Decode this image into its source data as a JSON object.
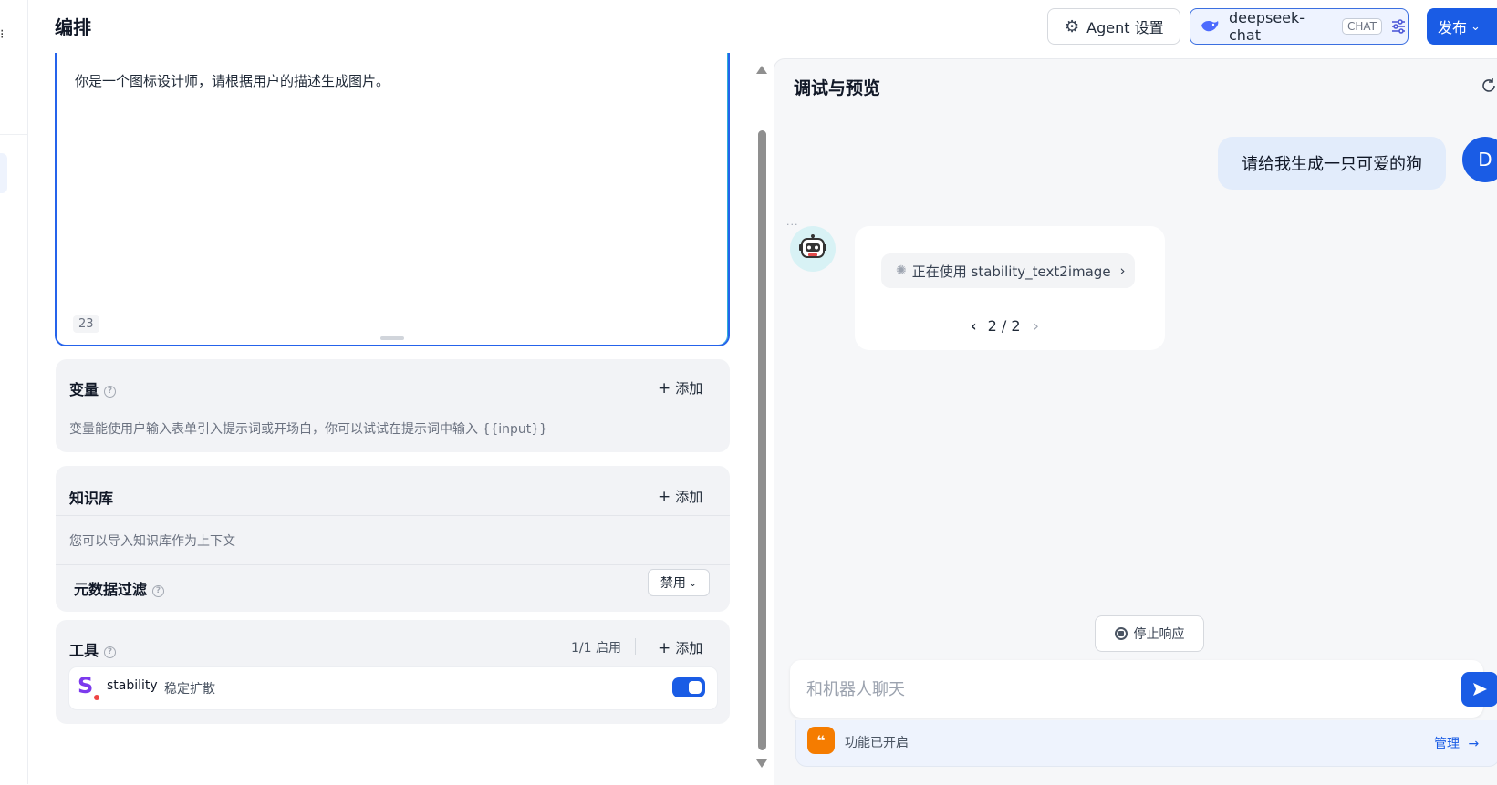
{
  "header": {
    "title": "编排",
    "agent_settings_label": "Agent 设置",
    "model_name": "deepseek-chat",
    "model_badge": "CHAT",
    "publish_label": "发布"
  },
  "prompt": {
    "text": "你是一个图标设计师，请根据用户的描述生成图片。",
    "char_count": "23"
  },
  "variables": {
    "title": "变量",
    "add_label": "添加",
    "description": "变量能使用户输入表单引入提示词或开场白，你可以试试在提示词中输入 {{input}}"
  },
  "knowledge": {
    "title": "知识库",
    "add_label": "添加",
    "description": "您可以导入知识库作为上下文",
    "metadata_filter_label": "元数据过滤",
    "metadata_filter_value": "禁用"
  },
  "tools": {
    "title": "工具",
    "enabled_count": "1/1 启用",
    "add_label": "添加",
    "items": [
      {
        "logo": "S",
        "name": "stability",
        "description": "稳定扩散",
        "enabled": true
      }
    ]
  },
  "preview": {
    "title": "调试与预览",
    "user_message": "请给我生成一只可爱的狗",
    "user_avatar_letter": "D",
    "bot_tool_status": "正在使用 stability_text2image",
    "pager": "2 / 2",
    "stop_label": "停止响应",
    "input_placeholder": "和机器人聊天",
    "feature_status": "功能已开启",
    "manage_label": "管理"
  },
  "colors": {
    "primary": "#1a5ce5",
    "panel_bg": "#f2f3f6",
    "user_bubble": "#e2ecfb",
    "feature_icon": "#f57c00"
  },
  "icons": {
    "agent_settings": "gear-icon",
    "model": "whale-icon",
    "model_params": "sliders-icon",
    "publish": "chevron-down-icon",
    "refresh": "refresh-icon",
    "send": "send-icon",
    "stop": "stop-icon",
    "feature": "quote-icon"
  }
}
